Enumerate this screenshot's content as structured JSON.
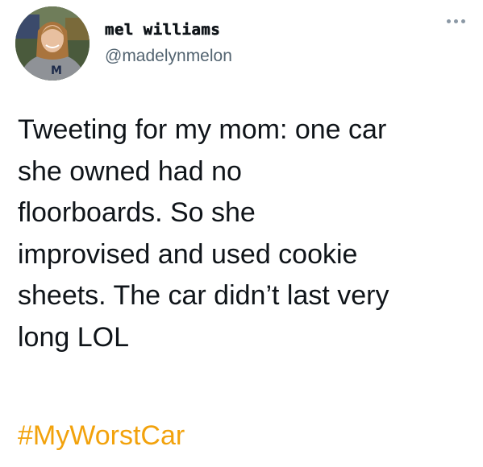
{
  "user": {
    "display_name": "mel williams",
    "handle": "@madelynmelon",
    "avatar_icon": "profile-photo"
  },
  "more_icon": "ellipsis-icon",
  "tweet": {
    "lines": [
      "Tweeting for my mom: one car",
      "she owned had no",
      "floorboards. So she",
      "improvised and used cookie",
      "sheets. The car didn’t last very",
      "long LOL"
    ],
    "hashtag": "#MyWorstCar"
  },
  "colors": {
    "text": "#0f1419",
    "secondary": "#536471",
    "hashtag": "#f2a20c",
    "background": "#ffffff"
  }
}
